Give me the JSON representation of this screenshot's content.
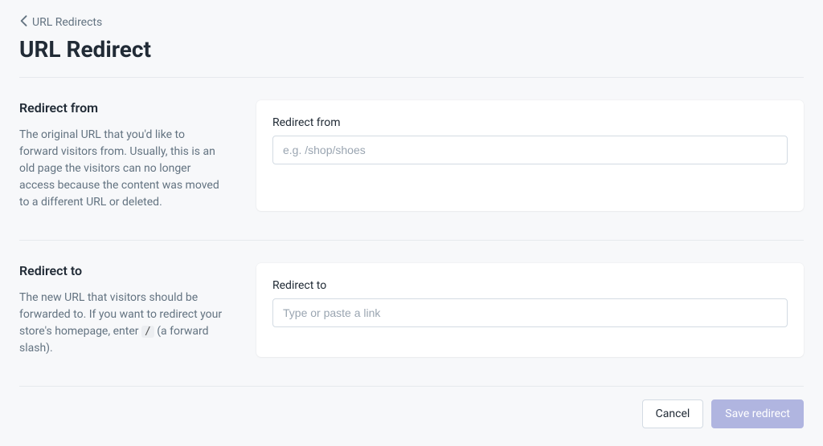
{
  "breadcrumb": {
    "label": "URL Redirects"
  },
  "page": {
    "title": "URL Redirect"
  },
  "sections": {
    "from": {
      "heading": "Redirect from",
      "description": "The original URL that you'd like to forward visitors from. Usually, this is an old page the visitors can no longer access because the content was moved to a different URL or deleted.",
      "field_label": "Redirect from",
      "placeholder": "e.g. /shop/shoes",
      "value": ""
    },
    "to": {
      "heading": "Redirect to",
      "description_pre": "The new URL that visitors should be forwarded to. If you want to redirect your store's homepage, enter ",
      "description_code": "/",
      "description_post": " (a forward slash).",
      "field_label": "Redirect to",
      "placeholder": "Type or paste a link",
      "value": ""
    }
  },
  "footer": {
    "cancel": "Cancel",
    "save": "Save redirect"
  }
}
